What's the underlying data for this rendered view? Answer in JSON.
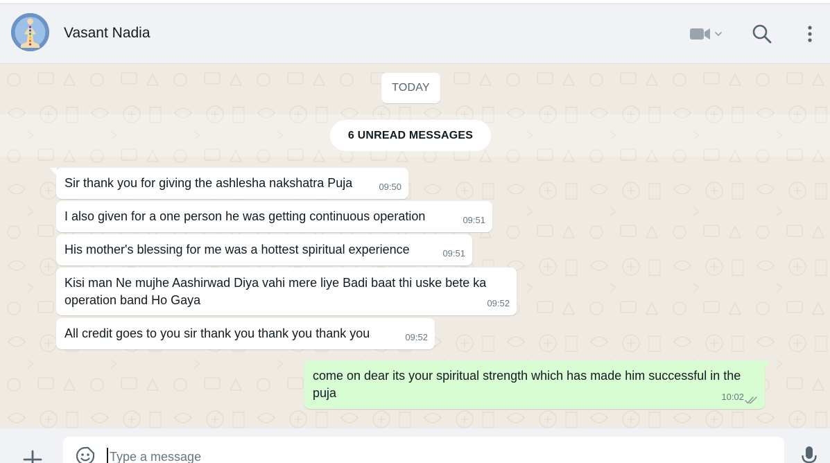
{
  "colors": {
    "header_bg": "#f0f2f5",
    "chat_bg": "#efeae2",
    "incoming_bubble": "#ffffff",
    "outgoing_bubble": "#d9fdd3",
    "icon": "#54656f",
    "read_ticks": "#8696a0"
  },
  "header": {
    "contact_name": "Vasant Nadia",
    "icons": [
      "video-call-icon",
      "chevron-down-icon",
      "search-icon",
      "menu-icon"
    ]
  },
  "chat": {
    "date_label": "TODAY",
    "unread_label": "6 UNREAD MESSAGES",
    "messages": [
      {
        "direction": "in",
        "text": "Sir thank you for giving the ashlesha nakshatra Puja",
        "time": "09:50"
      },
      {
        "direction": "in",
        "text": "I also given for a one person he was getting continuous operation",
        "time": "09:51"
      },
      {
        "direction": "in",
        "text": "His mother's blessing for me was a hottest spiritual experience",
        "time": "09:51"
      },
      {
        "direction": "in",
        "text": "Kisi man Ne mujhe Aashirwad Diya vahi mere liye Badi baat thi uske bete ka operation band Ho Gaya",
        "time": "09:52"
      },
      {
        "direction": "in",
        "text": "All credit goes to you sir thank you thank you thank you",
        "time": "09:52"
      },
      {
        "direction": "out",
        "text": "come on dear its your spiritual strength which has made him successful in the puja",
        "time": "10:02",
        "status": "read"
      }
    ]
  },
  "composer": {
    "placeholder": "Type a message",
    "value": "",
    "icons": [
      "plus-icon",
      "emoji-icon",
      "mic-icon"
    ]
  }
}
